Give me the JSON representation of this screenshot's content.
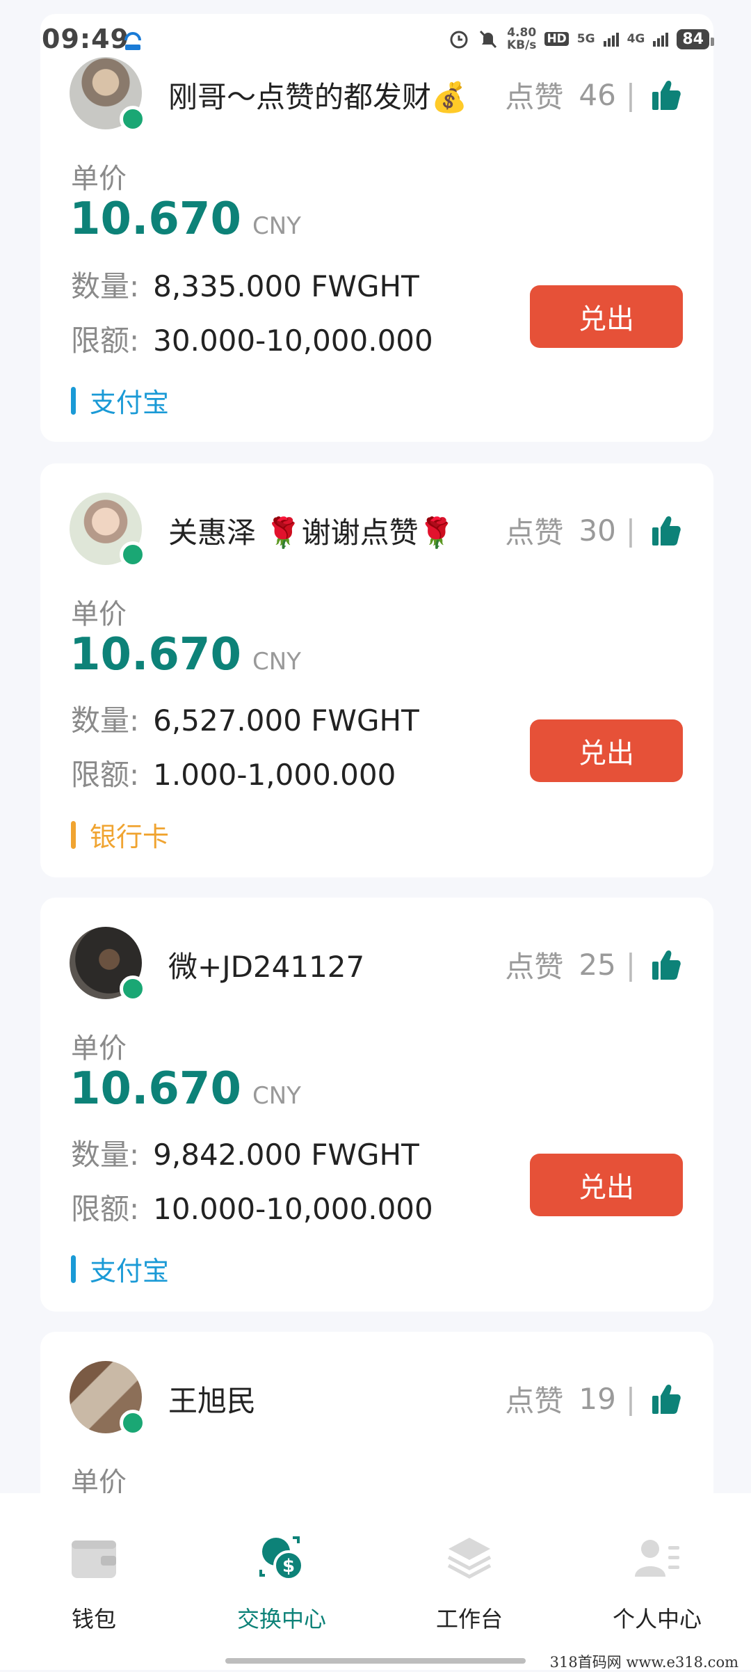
{
  "status_bar": {
    "time": "09:49",
    "speed_value": "4.80",
    "speed_unit": "KB/s",
    "hd_label": "HD",
    "net1": "5G",
    "net2": "4G",
    "battery": "84"
  },
  "offers": [
    {
      "username": "刚哥～点赞的都发财💰",
      "likes_label": "点赞",
      "likes_count": "46",
      "price_label": "单价",
      "price": "10.670",
      "currency": "CNY",
      "qty_label": "数量:",
      "qty": "8,335.000 FWGHT",
      "limit_label": "限额:",
      "limit": "30.000-10,000.000",
      "action": "兑出",
      "payment": "支付宝"
    },
    {
      "username": "关惠泽 🌹谢谢点赞🌹",
      "likes_label": "点赞",
      "likes_count": "30",
      "price_label": "单价",
      "price": "10.670",
      "currency": "CNY",
      "qty_label": "数量:",
      "qty": "6,527.000 FWGHT",
      "limit_label": "限额:",
      "limit": "1.000-1,000.000",
      "action": "兑出",
      "payment": "银行卡"
    },
    {
      "username": "微+JD241127",
      "likes_label": "点赞",
      "likes_count": "25",
      "price_label": "单价",
      "price": "10.670",
      "currency": "CNY",
      "qty_label": "数量:",
      "qty": "9,842.000 FWGHT",
      "limit_label": "限额:",
      "limit": "10.000-10,000.000",
      "action": "兑出",
      "payment": "支付宝"
    },
    {
      "username": "王旭民",
      "likes_label": "点赞",
      "likes_count": "19",
      "price_label": "单价"
    }
  ],
  "tabs": [
    {
      "label": "钱包",
      "icon": "wallet-icon"
    },
    {
      "label": "交换中心",
      "icon": "exchange-icon"
    },
    {
      "label": "工作台",
      "icon": "layers-icon"
    },
    {
      "label": "个人中心",
      "icon": "profile-icon"
    }
  ],
  "watermark": "318首码网  www.e318.com",
  "colors": {
    "accent": "#0d8278",
    "button": "#e65138",
    "alipay": "#1a9ad6",
    "bank": "#f0a431",
    "online": "#1aa774"
  }
}
